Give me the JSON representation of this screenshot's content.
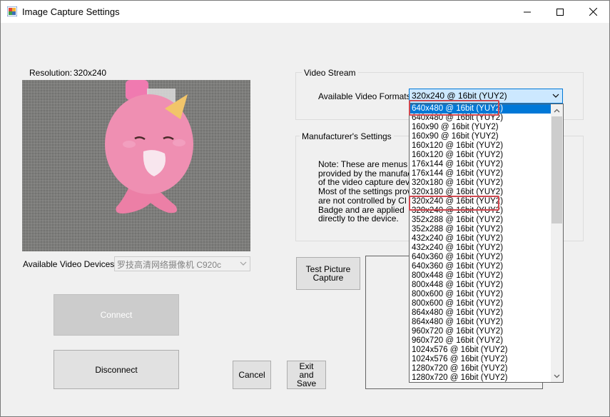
{
  "window": {
    "title": "Image Capture Settings",
    "minimize_icon": "minimize-icon",
    "maximize_icon": "maximize-icon",
    "close_icon": "close-icon"
  },
  "resolution": {
    "label": "Resolution:",
    "value": "320x240"
  },
  "devices": {
    "label": "Available Video Devices:",
    "selected": "罗技高清网络摄像机 C920c"
  },
  "buttons": {
    "connect": "Connect",
    "disconnect": "Disconnect",
    "cancel": "Cancel",
    "exit_save": "Exit and Save",
    "test_capture": "Test Picture Capture"
  },
  "video_stream": {
    "group_label": "Video Stream",
    "formats_label": "Available Video Formats:",
    "selected_format": "320x240 @ 16bit (YUY2)",
    "formats": [
      "640x480 @ 16bit (YUY2)",
      "640x480 @ 16bit (YUY2)",
      "160x90 @ 16bit (YUY2)",
      "160x90 @ 16bit (YUY2)",
      "160x120 @ 16bit (YUY2)",
      "160x120 @ 16bit (YUY2)",
      "176x144 @ 16bit (YUY2)",
      "176x144 @ 16bit (YUY2)",
      "320x180 @ 16bit (YUY2)",
      "320x180 @ 16bit (YUY2)",
      "320x240 @ 16bit (YUY2)",
      "320x240 @ 16bit (YUY2)",
      "352x288 @ 16bit (YUY2)",
      "352x288 @ 16bit (YUY2)",
      "432x240 @ 16bit (YUY2)",
      "432x240 @ 16bit (YUY2)",
      "640x360 @ 16bit (YUY2)",
      "640x360 @ 16bit (YUY2)",
      "800x448 @ 16bit (YUY2)",
      "800x448 @ 16bit (YUY2)",
      "800x600 @ 16bit (YUY2)",
      "800x600 @ 16bit (YUY2)",
      "864x480 @ 16bit (YUY2)",
      "864x480 @ 16bit (YUY2)",
      "960x720 @ 16bit (YUY2)",
      "960x720 @ 16bit (YUY2)",
      "1024x576 @ 16bit (YUY2)",
      "1024x576 @ 16bit (YUY2)",
      "1280x720 @ 16bit (YUY2)",
      "1280x720 @ 16bit (YUY2)"
    ],
    "highlighted_index": 0
  },
  "manufacturer": {
    "group_label": "Manufacturer's Settings",
    "note_lines": [
      "Note:  These are menus",
      "provided by the manufactu",
      "of the video capture devic",
      "Most of the settings provid",
      "are not controlled by CI",
      "Badge and are applied",
      "directly to the device."
    ]
  },
  "icons": {
    "combo_arrow": "chevron-down-icon",
    "scroll_up": "scroll-up-icon",
    "scroll_down": "scroll-down-icon"
  }
}
